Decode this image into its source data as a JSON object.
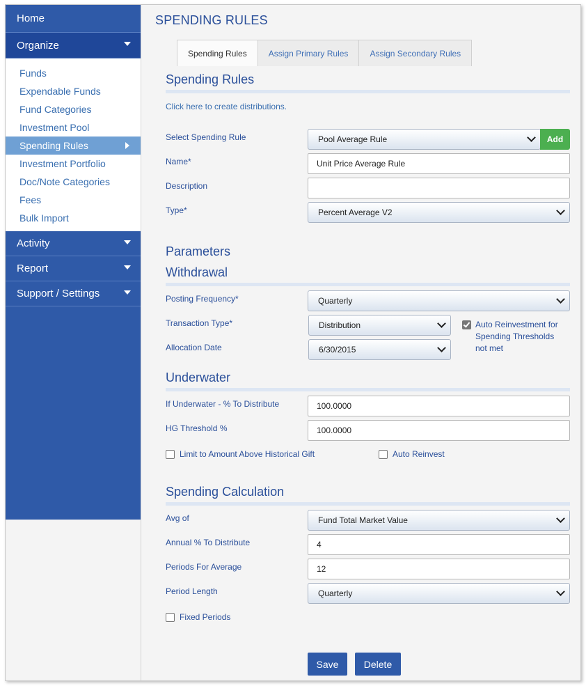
{
  "sidebar": {
    "home": "Home",
    "organize": "Organize",
    "items": [
      {
        "label": "Funds"
      },
      {
        "label": "Expendable Funds"
      },
      {
        "label": "Fund Categories"
      },
      {
        "label": "Investment Pool"
      },
      {
        "label": "Spending Rules"
      },
      {
        "label": "Investment Portfolio"
      },
      {
        "label": "Doc/Note Categories"
      },
      {
        "label": "Fees"
      },
      {
        "label": "Bulk Import"
      }
    ],
    "activity": "Activity",
    "report": "Report",
    "support": "Support / Settings"
  },
  "page": {
    "title": "SPENDING RULES",
    "tabs": [
      "Spending Rules",
      "Assign Primary Rules",
      "Assign Secondary Rules"
    ]
  },
  "form": {
    "heading": "Spending Rules",
    "create_link": "Click here to create distributions.",
    "select_rule_label": "Select Spending Rule",
    "select_rule_value": "Pool Average Rule",
    "add_label": "Add",
    "name_label": "Name*",
    "name_value": "Unit Price Average Rule",
    "description_label": "Description",
    "description_value": "",
    "type_label": "Type*",
    "type_value": "Percent Average V2"
  },
  "parameters": {
    "heading": "Parameters",
    "withdrawal_heading": "Withdrawal",
    "posting_frequency_label": "Posting Frequency*",
    "posting_frequency_value": "Quarterly",
    "transaction_type_label": "Transaction Type*",
    "transaction_type_value": "Distribution",
    "allocation_date_label": "Allocation Date",
    "allocation_date_value": "6/30/2015",
    "auto_reinvest_label": "Auto Reinvestment for Spending Thresholds not met",
    "auto_reinvest_checked": true
  },
  "underwater": {
    "heading": "Underwater",
    "pct_label": "If Underwater - % To Distribute",
    "pct_value": "100.0000",
    "hg_label": "HG Threshold %",
    "hg_value": "100.0000",
    "limit_label": "Limit to Amount Above Historical Gift",
    "auto_reinvest_label": "Auto Reinvest"
  },
  "calculation": {
    "heading": "Spending Calculation",
    "avg_of_label": "Avg of",
    "avg_of_value": "Fund Total Market Value",
    "annual_label": "Annual % To Distribute",
    "annual_value": "4",
    "periods_label": "Periods For Average",
    "periods_value": "12",
    "period_length_label": "Period Length",
    "period_length_value": "Quarterly",
    "fixed_periods_label": "Fixed Periods"
  },
  "actions": {
    "save": "Save",
    "delete": "Delete"
  }
}
